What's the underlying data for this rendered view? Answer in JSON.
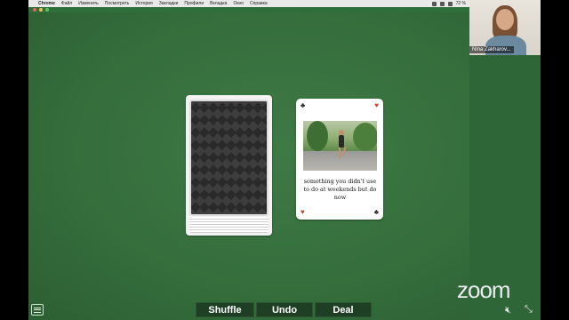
{
  "menubar": {
    "app": "Chrome",
    "items": [
      "Файл",
      "Изменить",
      "Посмотреть",
      "История",
      "Закладки",
      "Профили",
      "Вкладка",
      "Окно",
      "Справка"
    ],
    "battery": "72 %"
  },
  "video": {
    "participant": "Nina Zakharov..."
  },
  "card": {
    "caption": "something you didn't use to do at weekends but do now",
    "suit_top_left": "♣",
    "suit_top_right": "♥",
    "suit_bottom_left": "♥",
    "suit_bottom_right": "♣"
  },
  "toolbar": {
    "shuffle": "Shuffle",
    "undo": "Undo",
    "deal": "Deal"
  },
  "zoom": {
    "logo": "zoom"
  },
  "icons": {
    "menu": "menu-icon",
    "mute": "mute-icon",
    "shrink": "shrink-icon"
  }
}
